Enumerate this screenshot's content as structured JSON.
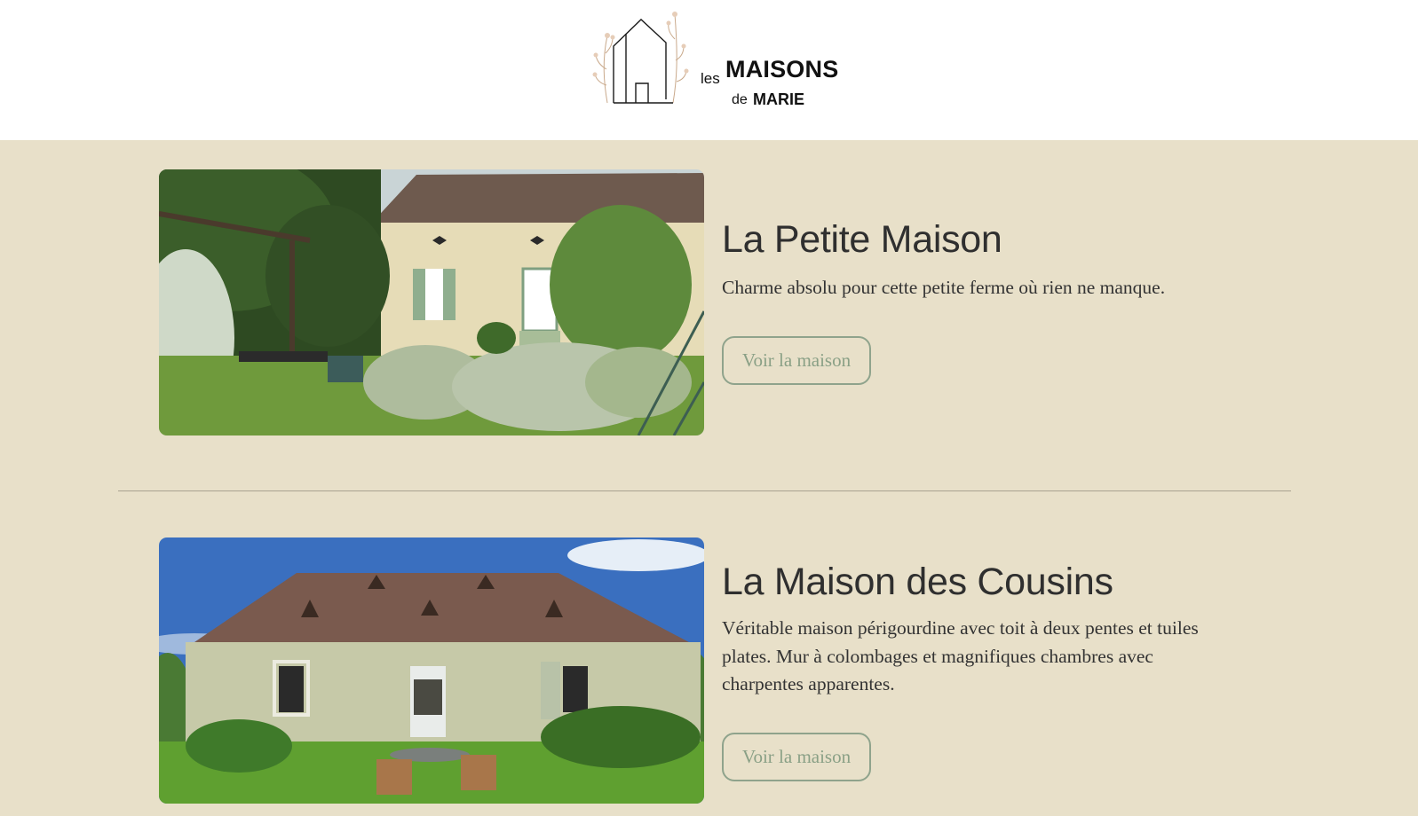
{
  "brand": {
    "les": "les",
    "maisons": "MAISONS",
    "de": "de",
    "marie": "MARIE",
    "logo_icon": "house-line-icon"
  },
  "colors": {
    "background": "#e8e0c9",
    "header": "#ffffff",
    "button_border": "#8fa38c",
    "button_text": "#8aa086",
    "heading": "#2f2f2f"
  },
  "houses": [
    {
      "title": "La Petite Maison",
      "description": "Charme absolu pour cette petite ferme où rien ne manque.",
      "button_label": "Voir la maison"
    },
    {
      "title": "La Maison des Cousins",
      "description": "Véritable maison périgourdine avec toit à deux pentes et tuiles plates. Mur à colombages et magnifiques chambres avec charpentes apparentes.",
      "button_label": "Voir la maison"
    }
  ]
}
